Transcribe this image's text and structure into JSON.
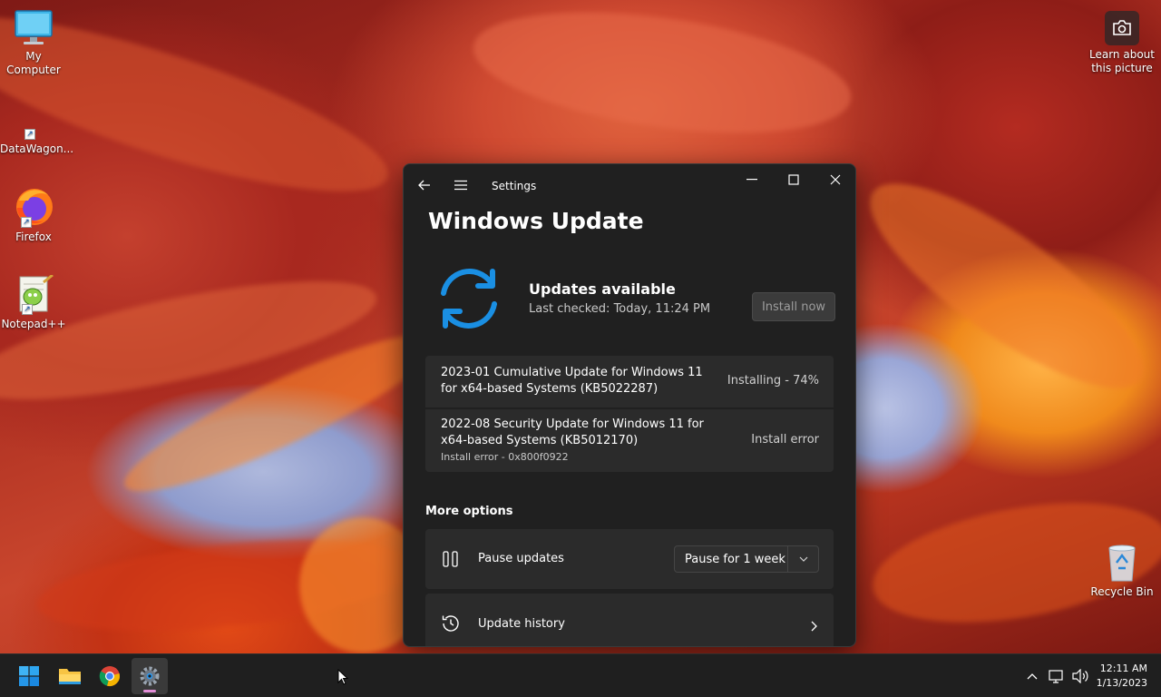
{
  "desktop": {
    "icons": [
      {
        "label": "My\nComputer"
      },
      {
        "label": "DataWagon..."
      },
      {
        "label": "Firefox"
      },
      {
        "label": "Notepad++"
      }
    ],
    "learn_about_picture": "Learn about\nthis picture",
    "recycle_bin": "Recycle Bin"
  },
  "window": {
    "app_title": "Settings",
    "page_title": "Windows Update",
    "status": {
      "title": "Updates available",
      "last_checked": "Last checked: Today, 11:24 PM",
      "install_button": "Install now"
    },
    "updates": [
      {
        "name": "2023-01 Cumulative Update for Windows 11 for x64-based Systems (KB5022287)",
        "state": "Installing - 74%",
        "progress": 0.74
      },
      {
        "name": "2022-08 Security Update for Windows 11 for x64-based Systems (KB5012170)",
        "state": "Install error",
        "error": "Install error - 0x800f0922"
      }
    ],
    "more_options": {
      "heading": "More options",
      "pause_updates": {
        "label": "Pause updates",
        "selected": "Pause for 1 week"
      },
      "update_history": {
        "label": "Update history"
      }
    }
  },
  "taskbar": {
    "apps": [
      "start-icon",
      "file-explorer-icon",
      "chrome-icon",
      "settings-icon"
    ],
    "active_app": "settings",
    "clock": {
      "time": "12:11 AM",
      "date": "1/13/2023"
    }
  },
  "colors": {
    "window_bg": "#202020",
    "card_bg": "#2b2b2b",
    "accent_blue": "#1a8fe3",
    "taskbar_bg": "#1f1f1f"
  }
}
